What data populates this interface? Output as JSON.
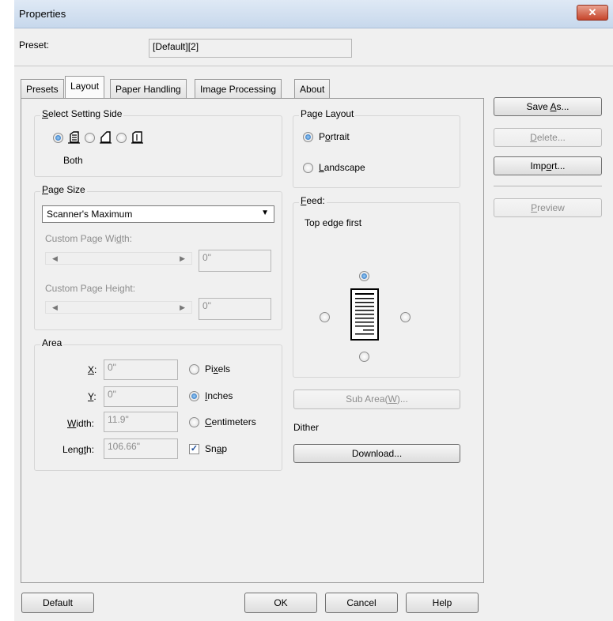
{
  "window": {
    "title": "Properties",
    "close_glyph": "✕"
  },
  "preset": {
    "label": "Preset:",
    "value": "[Default][2]"
  },
  "tabs": [
    "Presets",
    "Layout",
    "Paper Handling",
    "Image Processing",
    "About"
  ],
  "active_tab": "Layout",
  "select_setting_side": {
    "title_pre": "",
    "title_u": "S",
    "title_post": "elect Setting Side",
    "options": [
      "both-sides-icon",
      "front-side-icon",
      "back-side-icon"
    ],
    "selected": "Both"
  },
  "page_size": {
    "title_u": "P",
    "title_post": "age Size",
    "selected": "Scanner's Maximum",
    "width_label_pre": "Custom Page Wi",
    "width_label_u": "d",
    "width_label_post": "th:",
    "width_value": "0\"",
    "height_label": "Custom Page Height:",
    "height_value": "0\""
  },
  "area": {
    "title": "Area",
    "x": {
      "label_u": "X",
      "label_post": ":",
      "value": "0\""
    },
    "y": {
      "label_u": "Y",
      "label_post": ":",
      "value": "0\""
    },
    "width": {
      "label_u": "W",
      "label_post": "idth:",
      "value": "11.9\""
    },
    "length": {
      "label_pre": "Leng",
      "label_u": "t",
      "label_post": "h:",
      "value": "106.66\""
    },
    "units": {
      "pixels": {
        "pre": "Pi",
        "u": "x",
        "post": "els"
      },
      "inches": {
        "pre": "",
        "u": "I",
        "post": "nches"
      },
      "centimeters": {
        "pre": "",
        "u": "C",
        "post": "entimeters"
      },
      "selected": "inches"
    },
    "snap": {
      "pre": "Sn",
      "u": "a",
      "post": "p",
      "checked": true
    }
  },
  "page_layout": {
    "title": "Page Layout",
    "portrait": {
      "pre": "P",
      "u": "o",
      "post": "rtrait"
    },
    "landscape": {
      "pre": "",
      "u": "L",
      "post": "andscape"
    },
    "selected": "portrait"
  },
  "feed": {
    "title_u": "F",
    "title_post": "eed:",
    "value": "Top edge first",
    "selected_edge": "top"
  },
  "sub_area_button": {
    "pre": "Sub Area(",
    "u": "W",
    "post": ")..."
  },
  "dither": {
    "label": "Dither",
    "button": "Download..."
  },
  "side_buttons": {
    "save_as": {
      "pre": "Save ",
      "u": "A",
      "post": "s..."
    },
    "delete": {
      "pre": "",
      "u": "D",
      "post": "elete..."
    },
    "import": {
      "pre": "Imp",
      "u": "o",
      "post": "rt..."
    },
    "preview": {
      "pre": "",
      "u": "P",
      "post": "review"
    }
  },
  "bottom_buttons": {
    "default": "Default",
    "ok": "OK",
    "cancel": "Cancel",
    "help": "Help"
  },
  "colors": {
    "accent": "#1a64b8",
    "disabled_text": "#8d8d8d",
    "close_red": "#c6452b"
  }
}
